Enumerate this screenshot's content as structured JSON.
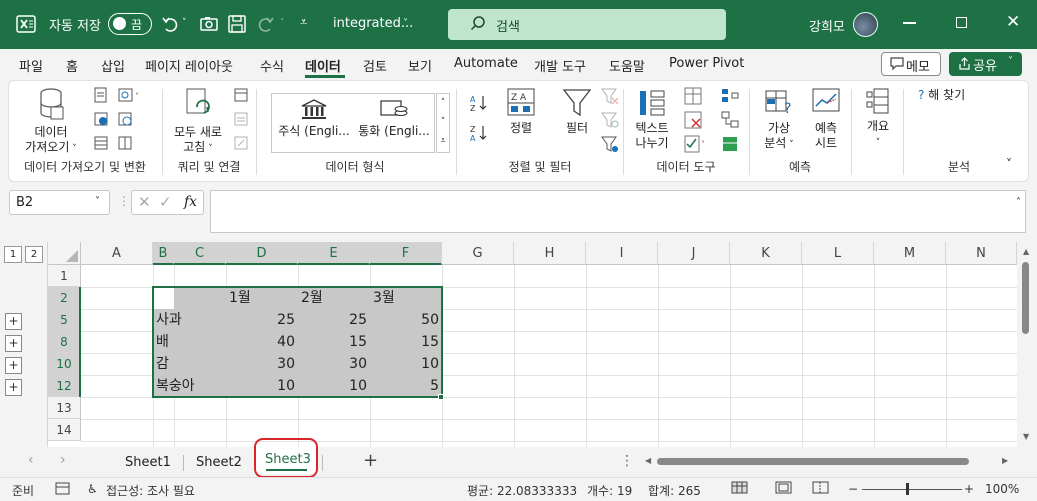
{
  "titlebar": {
    "autosave_label": "자동 저장",
    "autosave_state": "끔",
    "filename": "integrated...",
    "search_placeholder": "검색",
    "username": "강희모"
  },
  "tabs": [
    "파일",
    "홈",
    "삽입",
    "페이지 레이아웃",
    "수식",
    "데이터",
    "검토",
    "보기",
    "Automate",
    "개발 도구",
    "도움말",
    "Power Pivot"
  ],
  "active_tab": "데이터",
  "header_buttons": {
    "memo": "메모",
    "share": "공유"
  },
  "ribbon": {
    "get_data": {
      "btn1": "데이터",
      "btn2": "가져오기",
      "label": "데이터 가져오기 및 변환"
    },
    "queries": {
      "btn1": "모두 새로",
      "btn2": "고침",
      "label": "쿼리 및 연결"
    },
    "datatypes": {
      "stocks": "주식 (Engli...",
      "currency": "통화 (Engli...",
      "label": "데이터 형식"
    },
    "sort_filter": {
      "sort": "정렬",
      "filter": "필터",
      "label": "정렬 및 필터"
    },
    "data_tools": {
      "btn1": "텍스트",
      "btn2": "나누기",
      "label": "데이터 도구"
    },
    "forecast": {
      "whatif1": "가상",
      "whatif2": "분석",
      "sheet1": "예측",
      "sheet2": "시트",
      "label": "예측"
    },
    "outline": {
      "btn": "개요"
    },
    "analysis": {
      "solver": "해 찾기",
      "label": "분석"
    }
  },
  "formula_bar": {
    "namebox": "B2",
    "fx": "fx",
    "content": ""
  },
  "columns": [
    "A",
    "B",
    "C",
    "D",
    "E",
    "F",
    "G",
    "H",
    "I",
    "J",
    "K",
    "L",
    "M",
    "N"
  ],
  "outline_levels": [
    "1",
    "2"
  ],
  "rows": [
    "1",
    "2",
    "5",
    "8",
    "10",
    "12",
    "13",
    "14"
  ],
  "cells": {
    "header": [
      "",
      "1월",
      "2월",
      "3월"
    ],
    "data": [
      [
        "사과",
        "25",
        "25",
        "50"
      ],
      [
        "배",
        "40",
        "15",
        "15"
      ],
      [
        "감",
        "30",
        "30",
        "10"
      ],
      [
        "복숭아",
        "10",
        "10",
        "5"
      ]
    ]
  },
  "sheets": [
    "Sheet1",
    "Sheet2",
    "Sheet3"
  ],
  "active_sheet": "Sheet3",
  "status": {
    "ready": "준비",
    "accessibility": "접근성: 조사 필요",
    "average": "평균: 22.08333333",
    "count": "개수: 19",
    "sum": "합계: 265",
    "zoom": "100%"
  },
  "colors": {
    "excel_green": "#1e7145",
    "selection": "#c8c8c8",
    "highlight_ring": "#d9262c"
  }
}
